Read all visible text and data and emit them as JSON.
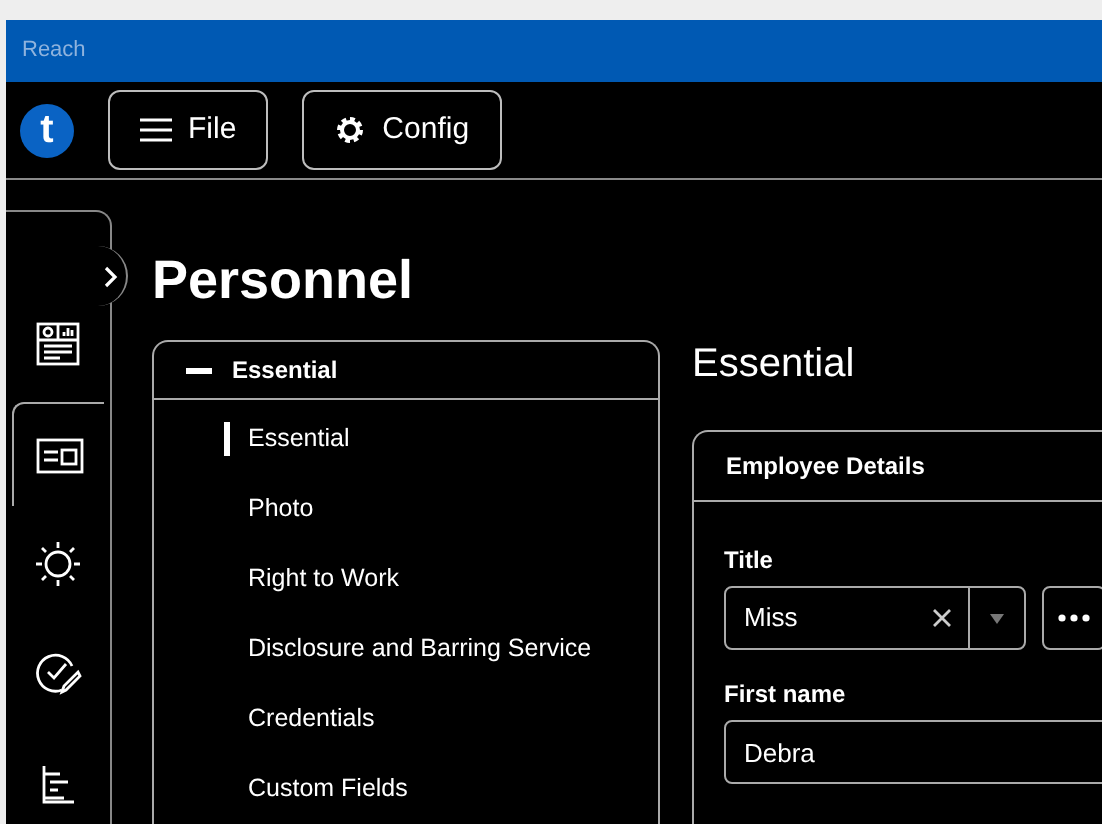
{
  "window": {
    "title": "Reach"
  },
  "toolbar": {
    "logo": "t",
    "buttons": [
      {
        "kind": "menu",
        "label": "File"
      },
      {
        "kind": "settings",
        "label": "Config"
      }
    ]
  },
  "page_title": "Personnel",
  "nav_rail": {
    "expanded": false,
    "items": [
      {
        "kind": "dashboard",
        "selected": false
      },
      {
        "kind": "id-card",
        "selected": true
      },
      {
        "kind": "sun",
        "selected": false
      },
      {
        "kind": "check-pen",
        "selected": false
      },
      {
        "kind": "chart",
        "selected": false
      }
    ]
  },
  "tree": {
    "group": {
      "label": "Essential",
      "expanded": true
    },
    "items": [
      {
        "label": "Essential",
        "selected": true
      },
      {
        "label": "Photo",
        "selected": false
      },
      {
        "label": "Right to Work",
        "selected": false
      },
      {
        "label": "Disclosure and Barring Service",
        "selected": false
      },
      {
        "label": "Credentials",
        "selected": false
      },
      {
        "label": "Custom Fields",
        "selected": false
      }
    ]
  },
  "section_heading": "Essential",
  "card": {
    "title": "Employee Details",
    "fields": [
      {
        "kind": "combo",
        "label": "Title",
        "value": "Miss"
      },
      {
        "kind": "text",
        "label": "First name",
        "value": "Debra"
      }
    ]
  }
}
